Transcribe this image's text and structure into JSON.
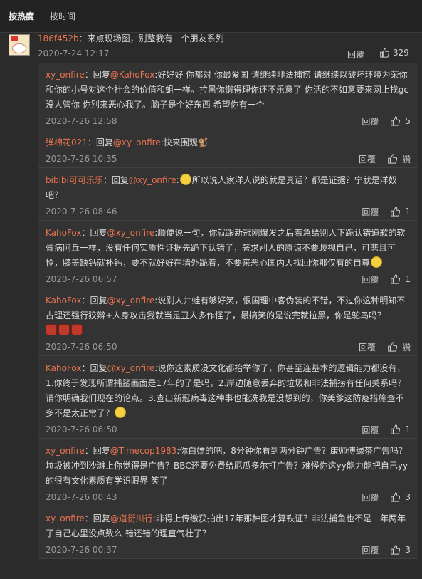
{
  "tabs": [
    "按热度",
    "按时间"
  ],
  "main_comment": {
    "user": "186f452b",
    "text": "：来点现场图，别整我有一个朋友系列",
    "time": "2020-7-24 12:17",
    "reply_label": "回覆",
    "likes": "329"
  },
  "replies": [
    {
      "user": "xy_onfire",
      "prefix": "：回复",
      "at": "@KahoFox",
      "text": ":好好好 你都对 你最爱国 请继续非法捕捞 请继续以破坏环境为荣你和你的小号对这个社会的价值和蛆一样。拉黑你懒得理你还不乐意了 你活的不如意要来网上找gc没人管你 你别来恶心我了。脑子是个好东西 希望你有一个",
      "date": "2020-7-26 12:58",
      "reply_label": "回覆",
      "likes": "5"
    },
    {
      "user": "弹棉花021",
      "prefix": "：回复",
      "at": "@xy_onfire",
      "text": ":快来围观🐒",
      "date": "2020-7-26 10:35",
      "reply_label": "回覆",
      "likes": "讚"
    },
    {
      "user": "bibibi可可乐乐",
      "prefix": "：回复",
      "at": "@xy_onfire",
      "text": "所以说人家洋人说的就是真话？都是证据？宁就是洋奴吧？",
      "date": "2020-7-26 08:46",
      "reply_label": "回覆",
      "likes": "1"
    },
    {
      "user": "KahoFox",
      "prefix": "：回复",
      "at": "@xy_onfire",
      "text": ":顺便说一句，你就跟新冠刚爆发之后着急给别人下跪认错道歉的软骨病阿丘一样，没有任何实质性证据先跪下认错了，奢求别人的原谅不要歧视自己，可悲且可怜，膝盖缺钙就补钙，要不就好好在墙外跪着，不要来恶心国内人找回你那仅有的自尊",
      "date": "2020-7-26 06:57",
      "reply_label": "回覆",
      "likes": "1"
    },
    {
      "user": "KahoFox",
      "prefix": "：回复",
      "at": "@xy_onfire",
      "text": ":说别人井蛙有够好笑，恨国理中客伪装的不错，不过你这种明知不占理还强行狡辩+人身攻击我就当是丑人多作怪了，最搞笑的是说完就拉黑，你是鸵鸟吗？",
      "date": "2020-7-26 06:50",
      "reply_label": "回覆",
      "likes": "讚"
    },
    {
      "user": "KahoFox",
      "prefix": "：回复",
      "at": "@xy_onfire",
      "text": ":说你这素质没文化都抬举你了，你甚至连基本的逻辑能力都没有，1.你终于发现所谓捕鲨画面是17年的了是吗，2.岸边随意丢弃的垃圾和非法捕捞有任何关系吗？请你明确我们现在的论点。3.查出新冠病毒这种事也能洗我是没想到的，你美爹这防疫措施查不多不是太正常了？",
      "date": "2020-7-26 06:50",
      "reply_label": "回覆",
      "likes": "1"
    },
    {
      "user": "xy_onfire",
      "prefix": "：回复",
      "at": "@Timecop1983",
      "text": ":你白嫖的吧，8分钟你看到两分钟广告？康师傅绿茶广告吗？垃圾被冲到沙滩上你觉得是广告？BBC还要免费给厄瓜多尔打广告？难怪你这yy能力能把自己yy的很有文化素质有学识眼界 笑了",
      "date": "2020-7-26 00:43",
      "reply_label": "回覆",
      "likes": "3"
    },
    {
      "user": "xy_onfire",
      "prefix": "：回复",
      "at": "@道衍川行",
      "text": ":非得上传缴获拍出17年那种图才算铁证？非法捕鱼也不是一年两年了自己心里没点数么 错还错的理直气壮了？",
      "date": "2020-7-26 00:37",
      "reply_label": "回覆",
      "likes": "3"
    }
  ]
}
